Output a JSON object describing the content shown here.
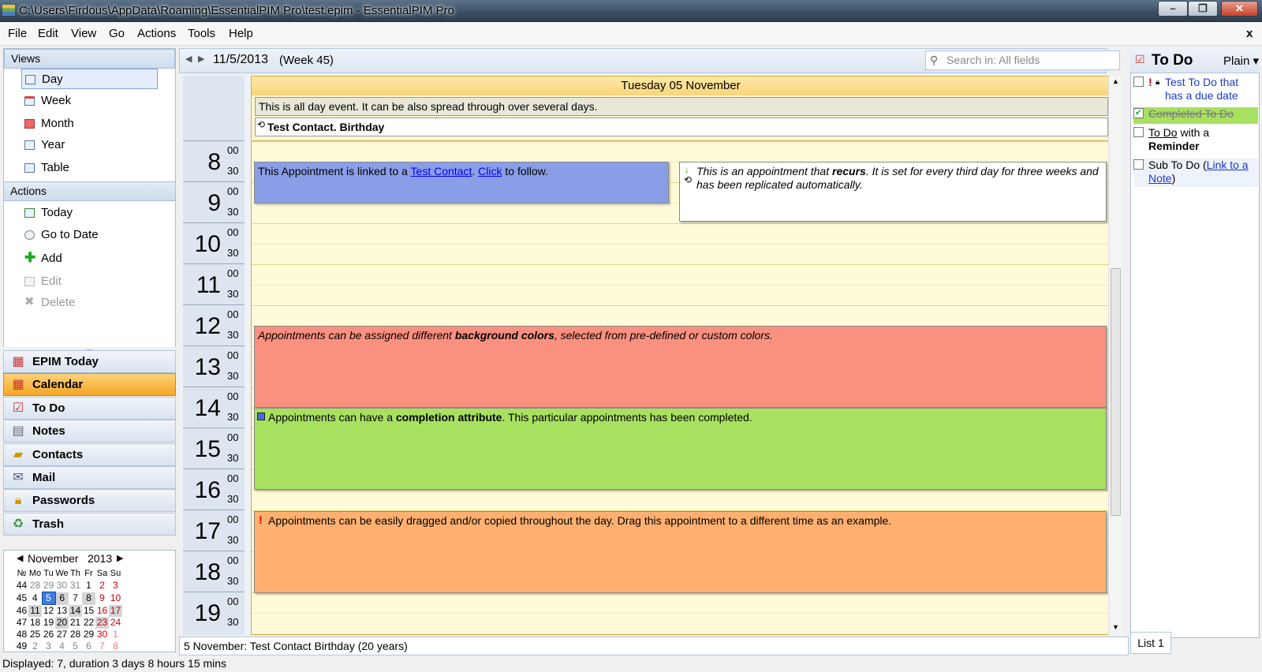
{
  "window": {
    "title": "C:\\Users\\Firdous\\AppData\\Roaming\\EssentialPIM Pro\\test.epim - EssentialPIM Pro"
  },
  "menu": [
    "File",
    "Edit",
    "View",
    "Go",
    "Actions",
    "Tools",
    "Help"
  ],
  "menu_close": "x",
  "views": {
    "header": "Views",
    "items": [
      "Day",
      "Week",
      "Month",
      "Year",
      "Table"
    ]
  },
  "actions": {
    "header": "Actions",
    "items": [
      "Today",
      "Go to Date",
      "Add",
      "Edit",
      "Delete"
    ]
  },
  "nav": [
    "EPIM Today",
    "Calendar",
    "To Do",
    "Notes",
    "Contacts",
    "Mail",
    "Passwords",
    "Trash"
  ],
  "minical": {
    "month": "November",
    "year": "2013",
    "headers": [
      "№",
      "Mo",
      "Tu",
      "We",
      "Th",
      "Fr",
      "Sa",
      "Su"
    ],
    "weeks": [
      [
        "44",
        "28",
        "29",
        "30",
        "31",
        "1",
        "2",
        "3"
      ],
      [
        "45",
        "4",
        "5",
        "6",
        "7",
        "8",
        "9",
        "10"
      ],
      [
        "46",
        "11",
        "12",
        "13",
        "14",
        "15",
        "16",
        "17"
      ],
      [
        "47",
        "18",
        "19",
        "20",
        "21",
        "22",
        "23",
        "24"
      ],
      [
        "48",
        "25",
        "26",
        "27",
        "28",
        "29",
        "30",
        "1"
      ],
      [
        "49",
        "2",
        "3",
        "4",
        "5",
        "6",
        "7",
        "8"
      ]
    ]
  },
  "datebar": {
    "date": "11/5/2013",
    "week": "(Week 45)"
  },
  "search": {
    "placeholder": "Search in: All fields"
  },
  "day": {
    "header": "Tuesday 05 November"
  },
  "allday": [
    "This is all day event. It can be also spread through over several days.",
    "Test Contact. Birthday"
  ],
  "hours": [
    "8",
    "9",
    "10",
    "11",
    "12",
    "13",
    "14",
    "15",
    "16",
    "17",
    "18",
    "19"
  ],
  "minutes": [
    "00",
    "30"
  ],
  "appointments": {
    "a1": {
      "pre": "This Appointment is linked to a ",
      "link1": "Test Contact",
      "mid": ". ",
      "link2": "Click",
      "post": " to follow."
    },
    "a2": {
      "pre": "This is an appointment that ",
      "bold": "recurs",
      "post": ". It is set for every third day for three weeks and has been replicated automatically."
    },
    "a3": {
      "pre": "Appointments can be assigned different ",
      "bold": "background colors",
      "post": ", selected from pre-defined or custom colors."
    },
    "a4": {
      "pre": "Appointments can have a ",
      "bold": "completion attribute",
      "post": ". This particular appointments has been completed."
    },
    "a5": {
      "text": "Appointments can be easily dragged and/or copied throughout the day. Drag this appointment to a different time as an example."
    }
  },
  "bottom_info": "5 November:  Test Contact Birthday  (20 years)",
  "status": "Displayed: 7, duration 3 days 8 hours 15 mins",
  "todo": {
    "title": "To Do",
    "mode": "Plain",
    "items": [
      {
        "text": "Test To Do that has a due date",
        "done": false
      },
      {
        "text": "Completed To Do",
        "done": true
      },
      {
        "pre": "To Do",
        "mid": " with a ",
        "bold": "Reminder",
        "done": false
      },
      {
        "pre": "Sub To Do (",
        "link": "Link to a Note",
        "post": ")",
        "done": false
      }
    ],
    "tab": "List 1"
  },
  "colors": {
    "accent": "#f5a623",
    "appt_blue": "#8a9ee8",
    "appt_red": "#fa9080",
    "appt_green": "#a8e060",
    "appt_orange": "#ffb070",
    "grid": "#fffbd8"
  }
}
